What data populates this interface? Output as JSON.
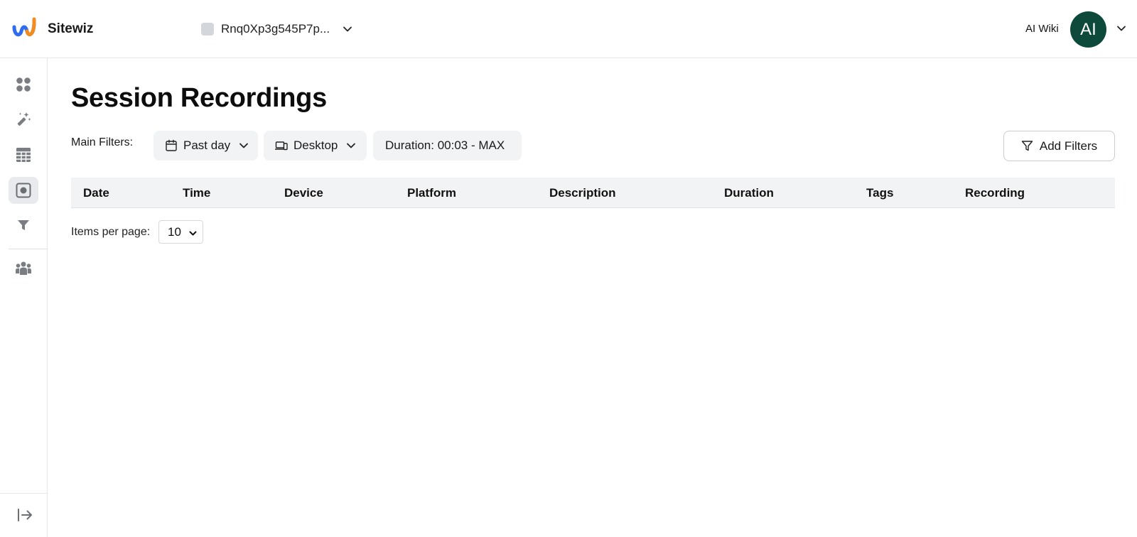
{
  "brand": {
    "name": "Sitewiz",
    "icon": "sitewiz-logo"
  },
  "header": {
    "site_selector": {
      "value": "Rnq0Xp3g545P7p...",
      "icon": "chevron-down-icon"
    },
    "wiki_link": "AI Wiki",
    "avatar_initials": "AI",
    "avatar_color": "#0d4a3c"
  },
  "sidebar": {
    "items": [
      {
        "icon": "dashboard-icon",
        "active": false
      },
      {
        "icon": "magic-wand-icon",
        "active": false
      },
      {
        "icon": "table-grid-icon",
        "active": false
      },
      {
        "icon": "session-recording-icon",
        "active": true
      },
      {
        "icon": "funnel-icon",
        "active": false
      },
      {
        "icon": "users-group-icon",
        "active": false
      }
    ],
    "collapse_icon": "expand-sidebar-icon"
  },
  "page": {
    "title": "Session Recordings",
    "filters_label": "Main Filters:",
    "filters": {
      "date_range": "Past day",
      "device": "Desktop",
      "duration": "Duration: 00:03 - MAX"
    },
    "add_filters_label": "Add Filters"
  },
  "table": {
    "columns": [
      "Date",
      "Time",
      "Device",
      "Platform",
      "Description",
      "Duration",
      "Tags",
      "Recording"
    ],
    "rows": []
  },
  "pagination": {
    "items_per_page_label": "Items per page:",
    "items_per_page_value": "10"
  },
  "colors": {
    "accent_dark_green": "#0d4a3c",
    "chip_bg": "#f2f3f5",
    "logo_blue": "#2f6df0",
    "logo_orange": "#f28c1e"
  }
}
